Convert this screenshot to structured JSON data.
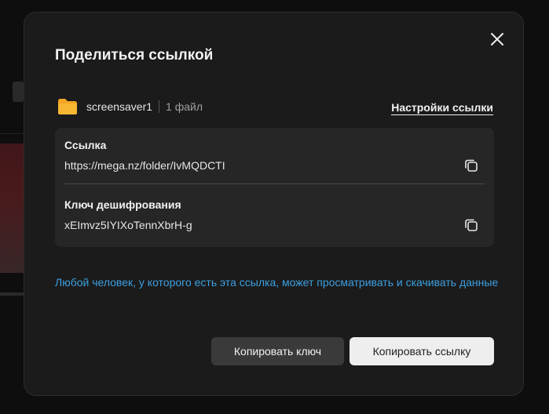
{
  "dialog": {
    "title": "Поделиться ссылкой",
    "close_icon": "close-icon"
  },
  "file": {
    "icon": "folder-icon",
    "icon_color": "#f5a623",
    "name": "screensaver1",
    "count": "1 файл"
  },
  "link_settings_label": "Настройки ссылки",
  "link": {
    "label": "Ссылка",
    "value": "https://mega.nz/folder/IvMQDCTI",
    "copy_icon": "copy-icon"
  },
  "key": {
    "label": "Ключ дешифрования",
    "value": "xEImvz5IYIXoTennXbrH-g",
    "copy_icon": "copy-icon"
  },
  "info_text": "Любой человек, у которого есть эта ссылка, может просматривать и скачивать данные",
  "buttons": {
    "copy_key": "Копировать ключ",
    "copy_link": "Копировать ссылку"
  },
  "colors": {
    "info_text": "#3c9fe0",
    "dialog_bg": "#1b1b1b",
    "panel_bg": "#262626",
    "primary_button": "#eeeeee",
    "secondary_button": "#3a3a3a"
  }
}
